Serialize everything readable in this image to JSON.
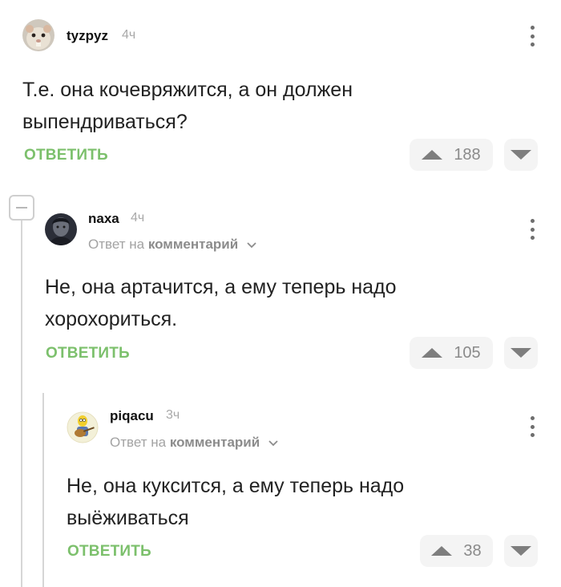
{
  "comments": [
    {
      "username": "tyzpyz",
      "time": "4ч",
      "text": "Т.е. она кочевряжится, а он должен выпендриваться?",
      "reply_label": "ОТВЕТИТЬ",
      "votes": "188",
      "avatar_icon": "hamster-avatar-icon"
    },
    {
      "username": "naxa",
      "time": "4ч",
      "reply_to_prefix": "Ответ на",
      "reply_to_link": "комментарий",
      "text": "Не, она артачится, а ему теперь надо хорохориться.",
      "reply_label": "ОТВЕТИТЬ",
      "votes": "105",
      "avatar_icon": "portrait-avatar-icon"
    },
    {
      "username": "piqacu",
      "time": "3ч",
      "reply_to_prefix": "Ответ на",
      "reply_to_link": "комментарий",
      "text": "Не, она куксится, а ему теперь надо выёживаться",
      "reply_label": "ОТВЕТИТЬ",
      "votes": "38",
      "avatar_icon": "guitarist-avatar-icon"
    }
  ],
  "colors": {
    "reply_green": "#7cc06c",
    "meta_gray": "#a8a8a8",
    "vote_bg": "#f4f4f4"
  }
}
